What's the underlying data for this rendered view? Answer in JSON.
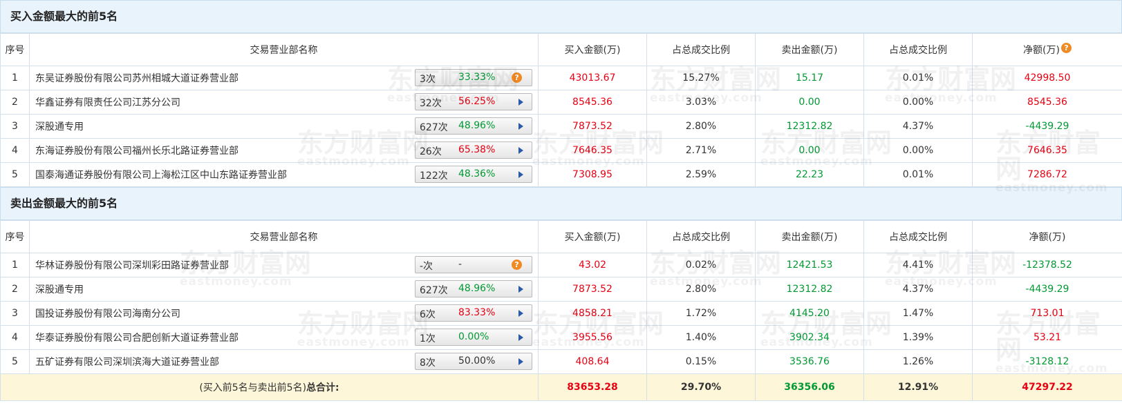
{
  "buy_section": {
    "title": "买入金额最大的前5名",
    "headers": [
      "序号",
      "交易营业部名称",
      "买入金额(万)",
      "占总成交比例",
      "卖出金额(万)",
      "占总成交比例",
      "净额(万)"
    ],
    "help_icon": "question-icon",
    "rows": [
      {
        "no": "1",
        "name": "东吴证券股份有限公司苏州相城大道证券营业部",
        "times": "3次",
        "rate": "33.33%",
        "rate_color": "#009933",
        "badge_icon": "question",
        "buy": "43013.67",
        "buy_ratio": "15.27%",
        "sell": "15.17",
        "sell_ratio": "0.01%",
        "net": "42998.50",
        "net_color": "#e60012"
      },
      {
        "no": "2",
        "name": "华鑫证券有限责任公司江苏分公司",
        "times": "32次",
        "rate": "56.25%",
        "rate_color": "#e60012",
        "badge_icon": "arrow",
        "buy": "8545.36",
        "buy_ratio": "3.03%",
        "sell": "0.00",
        "sell_ratio": "0.00%",
        "net": "8545.36",
        "net_color": "#e60012"
      },
      {
        "no": "3",
        "name": "深股通专用",
        "times": "627次",
        "rate": "48.96%",
        "rate_color": "#009933",
        "badge_icon": "arrow",
        "buy": "7873.52",
        "buy_ratio": "2.80%",
        "sell": "12312.82",
        "sell_ratio": "4.37%",
        "net": "-4439.29",
        "net_color": "#009933"
      },
      {
        "no": "4",
        "name": "东海证券股份有限公司福州长乐北路证券营业部",
        "times": "26次",
        "rate": "65.38%",
        "rate_color": "#e60012",
        "badge_icon": "arrow",
        "buy": "7646.35",
        "buy_ratio": "2.71%",
        "sell": "0.00",
        "sell_ratio": "0.00%",
        "net": "7646.35",
        "net_color": "#e60012"
      },
      {
        "no": "5",
        "name": "国泰海通证券股份有限公司上海松江区中山东路证券营业部",
        "times": "122次",
        "rate": "48.36%",
        "rate_color": "#009933",
        "badge_icon": "arrow",
        "buy": "7308.95",
        "buy_ratio": "2.59%",
        "sell": "22.23",
        "sell_ratio": "0.01%",
        "net": "7286.72",
        "net_color": "#e60012"
      }
    ]
  },
  "sell_section": {
    "title": "卖出金额最大的前5名",
    "headers": [
      "序号",
      "交易营业部名称",
      "买入金额(万)",
      "占总成交比例",
      "卖出金额(万)",
      "占总成交比例",
      "净额(万)"
    ],
    "rows": [
      {
        "no": "1",
        "name": "华林证券股份有限公司深圳彩田路证券营业部",
        "times": "-次",
        "rate": "-",
        "rate_color": "#333333",
        "badge_icon": "question",
        "buy": "43.02",
        "buy_ratio": "0.02%",
        "sell": "12421.53",
        "sell_ratio": "4.41%",
        "net": "-12378.52",
        "net_color": "#009933"
      },
      {
        "no": "2",
        "name": "深股通专用",
        "times": "627次",
        "rate": "48.96%",
        "rate_color": "#009933",
        "badge_icon": "arrow",
        "buy": "7873.52",
        "buy_ratio": "2.80%",
        "sell": "12312.82",
        "sell_ratio": "4.37%",
        "net": "-4439.29",
        "net_color": "#009933"
      },
      {
        "no": "3",
        "name": "国投证券股份有限公司海南分公司",
        "times": "6次",
        "rate": "83.33%",
        "rate_color": "#e60012",
        "badge_icon": "arrow",
        "buy": "4858.21",
        "buy_ratio": "1.72%",
        "sell": "4145.20",
        "sell_ratio": "1.47%",
        "net": "713.01",
        "net_color": "#e60012"
      },
      {
        "no": "4",
        "name": "华泰证券股份有限公司合肥创新大道证券营业部",
        "times": "1次",
        "rate": "0.00%",
        "rate_color": "#009933",
        "badge_icon": "arrow",
        "buy": "3955.56",
        "buy_ratio": "1.40%",
        "sell": "3902.34",
        "sell_ratio": "1.39%",
        "net": "53.21",
        "net_color": "#e60012"
      },
      {
        "no": "5",
        "name": "五矿证券有限公司深圳滨海大道证券营业部",
        "times": "8次",
        "rate": "50.00%",
        "rate_color": "#333333",
        "badge_icon": "arrow",
        "buy": "408.64",
        "buy_ratio": "0.15%",
        "sell": "3536.76",
        "sell_ratio": "1.26%",
        "net": "-3128.12",
        "net_color": "#009933"
      }
    ]
  },
  "total": {
    "label_prefix": "(买入前5名与卖出前5名)",
    "label_bold": "总合计:",
    "buy": "83653.28",
    "buy_ratio": "29.70%",
    "sell": "36356.06",
    "sell_ratio": "12.91%",
    "net": "47297.22"
  },
  "colors": {
    "red": "#e60012",
    "green": "#009933",
    "header_bg": "#e8f3fc",
    "total_bg": "#fdf6d9"
  },
  "watermark": {
    "cn": "东方财富网",
    "en": "eastmoney.com"
  }
}
